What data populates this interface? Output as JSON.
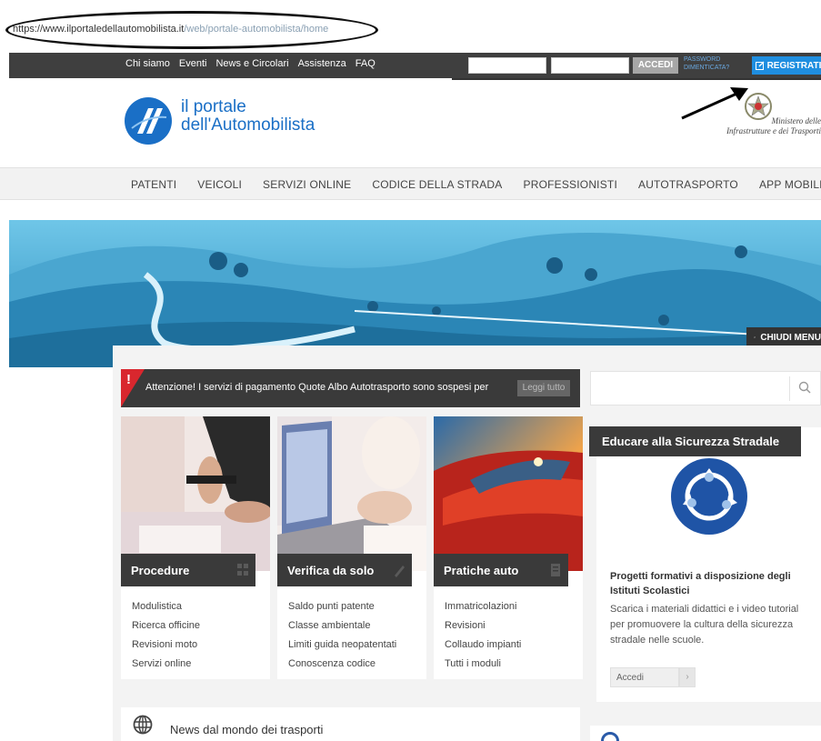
{
  "browser": {
    "url_host": "https://www.ilportaledellautomobilista.it",
    "url_path": "/web/portale-automobilista/home"
  },
  "topbar": {
    "links": [
      "Chi siamo",
      "Eventi",
      "News e Circolari",
      "Assistenza",
      "FAQ"
    ],
    "login_button": "ACCEDI",
    "password_forgot": "PASSWORD DIMENTICATA?",
    "register_button": "REGISTRATI"
  },
  "header": {
    "logo_line1": "il portale",
    "logo_line2": "dell'Automobilista",
    "ministry_line1": "Ministero delle",
    "ministry_line2": "Infrastrutture e dei Trasporti"
  },
  "nav": {
    "items": [
      "PATENTI",
      "VEICOLI",
      "SERVIZI ONLINE",
      "CODICE DELLA STRADA",
      "PROFESSIONISTI",
      "AUTOTRASPORTO",
      "APP MOBILE"
    ]
  },
  "banner": {
    "close_menu": "CHIUDI MENU"
  },
  "alert": {
    "text": "Attenzione! I servizi di pagamento Quote Albo Autotrasporto sono sospesi per",
    "button": "Leggi tutto"
  },
  "cards": [
    {
      "title": "Procedure",
      "links": [
        "Modulistica",
        "Ricerca officine",
        "Revisioni moto",
        "Servizi online"
      ]
    },
    {
      "title": "Verifica da solo",
      "links": [
        "Saldo punti patente",
        "Classe ambientale",
        "Limiti guida neopatentati",
        "Conoscenza codice"
      ]
    },
    {
      "title": "Pratiche auto",
      "links": [
        "Immatricolazioni",
        "Revisioni",
        "Collaudo impianti",
        "Tutti i moduli"
      ]
    }
  ],
  "education": {
    "header": "Educare alla Sicurezza Stradale",
    "title": "Progetti formativi a disposizione degli Istituti Scolastici",
    "text": "Scarica i materiali didattici e i video tutorial per promuovere la cultura della sicurezza stradale nelle scuole.",
    "select_value": "Accedi"
  },
  "news": {
    "title": "News dal mondo dei trasporti"
  },
  "colors": {
    "brand_blue": "#1a6fc6",
    "register_blue": "#1f8ee0",
    "alert_red": "#d9272e",
    "dark_bar": "#3a3a3a"
  }
}
